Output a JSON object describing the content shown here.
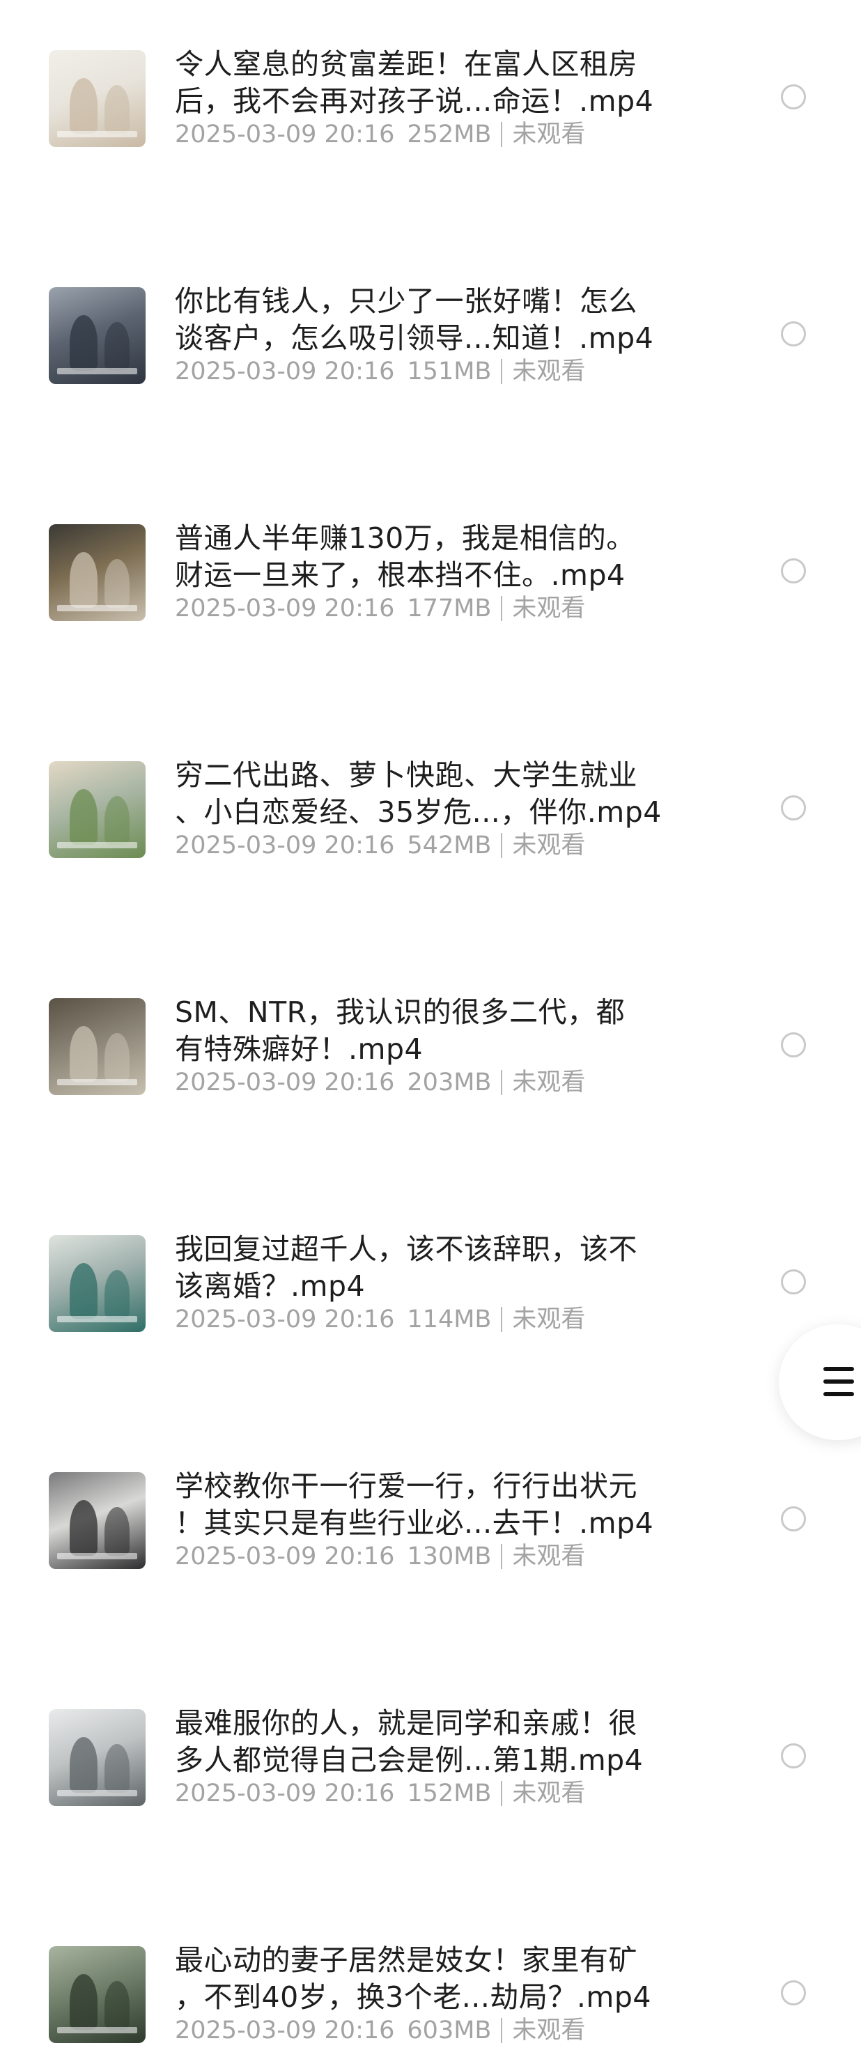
{
  "files": [
    {
      "title_line1": "令人窒息的贫富差距！在富人区租房",
      "title_line2": "后，我不会再对孩子说...命运！.mp4",
      "date": "2025-03-09 20:16",
      "size": "252MB",
      "status": "未观看",
      "thumb_colors": [
        "#e8e4dc",
        "#c9b9a4",
        "#f1efe9"
      ]
    },
    {
      "title_line1": "你比有钱人，只少了一张好嘴！怎么",
      "title_line2": "谈客户，怎么吸引领导...知道！.mp4",
      "date": "2025-03-09 20:16",
      "size": "151MB",
      "status": "未观看",
      "thumb_colors": [
        "#5b6470",
        "#2e3540",
        "#9aa3ad"
      ]
    },
    {
      "title_line1": "普通人半年赚130万，我是相信的。",
      "title_line2": "财运一旦来了，根本挡不住。.mp4",
      "date": "2025-03-09 20:16",
      "size": "177MB",
      "status": "未观看",
      "thumb_colors": [
        "#7d6d52",
        "#c9bfae",
        "#3b3a35"
      ]
    },
    {
      "title_line1": "穷二代出路、萝卜快跑、大学生就业",
      "title_line2": "、小白恋爱经、35岁危...，伴你.mp4",
      "date": "2025-03-09 20:16",
      "size": "542MB",
      "status": "未观看",
      "thumb_colors": [
        "#a9b6a4",
        "#6c8c52",
        "#e3d8c6"
      ]
    },
    {
      "title_line1": "SM、NTR，我认识的很多二代，都",
      "title_line2": "有特殊癖好！.mp4",
      "date": "2025-03-09 20:16",
      "size": "203MB",
      "status": "未观看",
      "thumb_colors": [
        "#8a8476",
        "#c7c0b0",
        "#5a5244"
      ]
    },
    {
      "title_line1": "我回复过超千人，该不该辞职，该不",
      "title_line2": "该离婚？.mp4",
      "date": "2025-03-09 20:16",
      "size": "114MB",
      "status": "未观看",
      "thumb_colors": [
        "#9fb0ac",
        "#2f6e66",
        "#dfe3df"
      ]
    },
    {
      "title_line1": "学校教你干一行爱一行，行行出状元",
      "title_line2": "！其实只是有些行业必...去干！.mp4",
      "date": "2025-03-09 20:16",
      "size": "130MB",
      "status": "未观看",
      "thumb_colors": [
        "#d8d8d6",
        "#2c2c2e",
        "#7a7a7c"
      ]
    },
    {
      "title_line1": "最难服你的人，就是同学和亲戚！很",
      "title_line2": "多人都觉得自己会是例...第1期.mp4",
      "date": "2025-03-09 20:16",
      "size": "152MB",
      "status": "未观看",
      "thumb_colors": [
        "#bfc3c4",
        "#5e6466",
        "#e9ebeb"
      ]
    },
    {
      "title_line1": "最心动的妻子居然是妓女！家里有矿",
      "title_line2": "，不到40岁，换3个老...劫局？.mp4",
      "date": "2025-03-09 20:16",
      "size": "603MB",
      "status": "未观看",
      "thumb_colors": [
        "#6f7f6a",
        "#2d3a2c",
        "#a8b4a0"
      ]
    }
  ]
}
